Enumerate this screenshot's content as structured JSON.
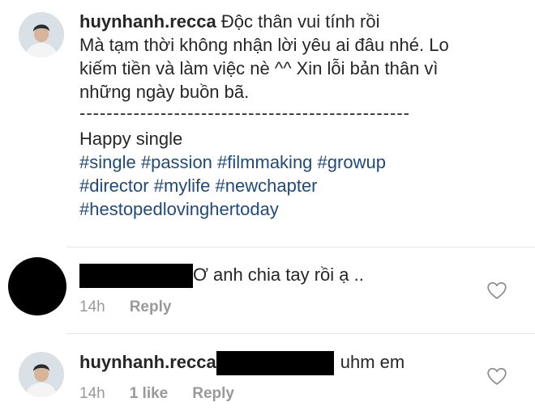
{
  "post": {
    "username": "huynhanh.recca",
    "caption_first": "Độc thân vui tính rồi",
    "caption_lines": [
      "Mà tạm thời không nhận lời yêu ai đâu nhé. Lo",
      "kiếm tiền và làm việc nè ^^ Xin lỗi bản thân vì",
      "những ngày buồn bã."
    ],
    "divider": "-------------------------------------------------",
    "happy": "Happy single",
    "hashtags": [
      [
        "#single",
        "#passion",
        "#filmmaking",
        "#growup"
      ],
      [
        "#director",
        "#mylife",
        "#newchapter"
      ],
      [
        "#hestopedlovinghertoday"
      ]
    ]
  },
  "comments": [
    {
      "username": "",
      "text": "Ơ anh chia tay rồi ạ ..",
      "time": "14h",
      "likes": "",
      "reply": "Reply",
      "heart_icon": "heart-outline-icon"
    },
    {
      "username": "huynhanh.recca",
      "text": "uhm em",
      "time": "14h",
      "likes": "1 like",
      "reply": "Reply",
      "heart_icon": "heart-outline-icon"
    }
  ],
  "colors": {
    "text": "#262626",
    "hashtag": "#1f4a7a",
    "meta": "#999999",
    "separator": "#e6e6e6"
  }
}
